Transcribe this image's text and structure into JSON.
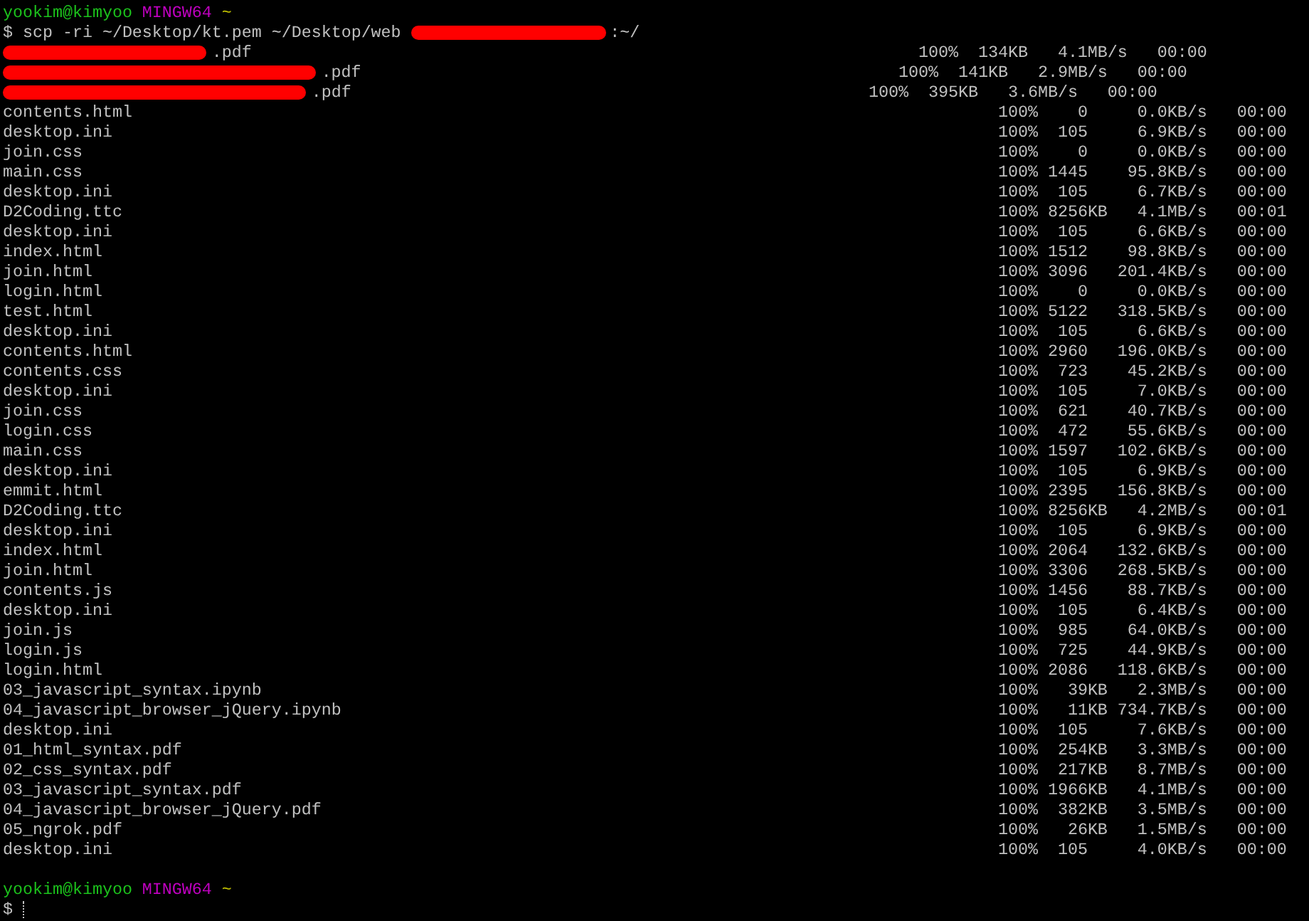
{
  "prompt": {
    "user_host": "yookim@kimyoo",
    "system": "MINGW64",
    "path": "~"
  },
  "command": {
    "text_before": "$ scp -ri ~/Desktop/kt.pem ~/Desktop/web",
    "text_after": ":~/"
  },
  "transfers": [
    {
      "kind": "redacted",
      "file": ".pdf",
      "transfer": "100%  134KB   4.1MB/s   00:00"
    },
    {
      "kind": "redacted",
      "file": ".pdf",
      "transfer": "100%  141KB   2.9MB/s   00:00"
    },
    {
      "kind": "redacted",
      "file": ".pdf",
      "transfer": "100%  395KB   3.6MB/s   00:00"
    },
    {
      "kind": "file",
      "file": "contents.html",
      "transfer": "100%    0     0.0KB/s   00:00"
    },
    {
      "kind": "file",
      "file": "desktop.ini",
      "transfer": "100%  105     6.9KB/s   00:00"
    },
    {
      "kind": "file",
      "file": "join.css",
      "transfer": "100%    0     0.0KB/s   00:00"
    },
    {
      "kind": "file",
      "file": "main.css",
      "transfer": "100% 1445    95.8KB/s   00:00"
    },
    {
      "kind": "file",
      "file": "desktop.ini",
      "transfer": "100%  105     6.7KB/s   00:00"
    },
    {
      "kind": "file",
      "file": "D2Coding.ttc",
      "transfer": "100% 8256KB   4.1MB/s   00:01"
    },
    {
      "kind": "file",
      "file": "desktop.ini",
      "transfer": "100%  105     6.6KB/s   00:00"
    },
    {
      "kind": "file",
      "file": "index.html",
      "transfer": "100% 1512    98.8KB/s   00:00"
    },
    {
      "kind": "file",
      "file": "join.html",
      "transfer": "100% 3096   201.4KB/s   00:00"
    },
    {
      "kind": "file",
      "file": "login.html",
      "transfer": "100%    0     0.0KB/s   00:00"
    },
    {
      "kind": "file",
      "file": "test.html",
      "transfer": "100% 5122   318.5KB/s   00:00"
    },
    {
      "kind": "file",
      "file": "desktop.ini",
      "transfer": "100%  105     6.6KB/s   00:00"
    },
    {
      "kind": "file",
      "file": "contents.html",
      "transfer": "100% 2960   196.0KB/s   00:00"
    },
    {
      "kind": "file",
      "file": "contents.css",
      "transfer": "100%  723    45.2KB/s   00:00"
    },
    {
      "kind": "file",
      "file": "desktop.ini",
      "transfer": "100%  105     7.0KB/s   00:00"
    },
    {
      "kind": "file",
      "file": "join.css",
      "transfer": "100%  621    40.7KB/s   00:00"
    },
    {
      "kind": "file",
      "file": "login.css",
      "transfer": "100%  472    55.6KB/s   00:00"
    },
    {
      "kind": "file",
      "file": "main.css",
      "transfer": "100% 1597   102.6KB/s   00:00"
    },
    {
      "kind": "file",
      "file": "desktop.ini",
      "transfer": "100%  105     6.9KB/s   00:00"
    },
    {
      "kind": "file",
      "file": "emmit.html",
      "transfer": "100% 2395   156.8KB/s   00:00"
    },
    {
      "kind": "file",
      "file": "D2Coding.ttc",
      "transfer": "100% 8256KB   4.2MB/s   00:01"
    },
    {
      "kind": "file",
      "file": "desktop.ini",
      "transfer": "100%  105     6.9KB/s   00:00"
    },
    {
      "kind": "file",
      "file": "index.html",
      "transfer": "100% 2064   132.6KB/s   00:00"
    },
    {
      "kind": "file",
      "file": "join.html",
      "transfer": "100% 3306   268.5KB/s   00:00"
    },
    {
      "kind": "file",
      "file": "contents.js",
      "transfer": "100% 1456    88.7KB/s   00:00"
    },
    {
      "kind": "file",
      "file": "desktop.ini",
      "transfer": "100%  105     6.4KB/s   00:00"
    },
    {
      "kind": "file",
      "file": "join.js",
      "transfer": "100%  985    64.0KB/s   00:00"
    },
    {
      "kind": "file",
      "file": "login.js",
      "transfer": "100%  725    44.9KB/s   00:00"
    },
    {
      "kind": "file",
      "file": "login.html",
      "transfer": "100% 2086   118.6KB/s   00:00"
    },
    {
      "kind": "file",
      "file": "03_javascript_syntax.ipynb",
      "transfer": "100%   39KB   2.3MB/s   00:00"
    },
    {
      "kind": "file",
      "file": "04_javascript_browser_jQuery.ipynb",
      "transfer": "100%   11KB 734.7KB/s   00:00"
    },
    {
      "kind": "file",
      "file": "desktop.ini",
      "transfer": "100%  105     7.6KB/s   00:00"
    },
    {
      "kind": "file",
      "file": "01_html_syntax.pdf",
      "transfer": "100%  254KB   3.3MB/s   00:00"
    },
    {
      "kind": "file",
      "file": "02_css_syntax.pdf",
      "transfer": "100%  217KB   8.7MB/s   00:00"
    },
    {
      "kind": "file",
      "file": "03_javascript_syntax.pdf",
      "transfer": "100% 1966KB   4.1MB/s   00:00"
    },
    {
      "kind": "file",
      "file": "04_javascript_browser_jQuery.pdf",
      "transfer": "100%  382KB   3.5MB/s   00:00"
    },
    {
      "kind": "file",
      "file": "05_ngrok.pdf",
      "transfer": "100%   26KB   1.5MB/s   00:00"
    },
    {
      "kind": "file",
      "file": "desktop.ini",
      "transfer": "100%  105     4.0KB/s   00:00"
    }
  ],
  "final_prompt": {
    "user_host": "yookim@kimyoo",
    "system": "MINGW64",
    "path": "~"
  },
  "input_prompt": "$"
}
